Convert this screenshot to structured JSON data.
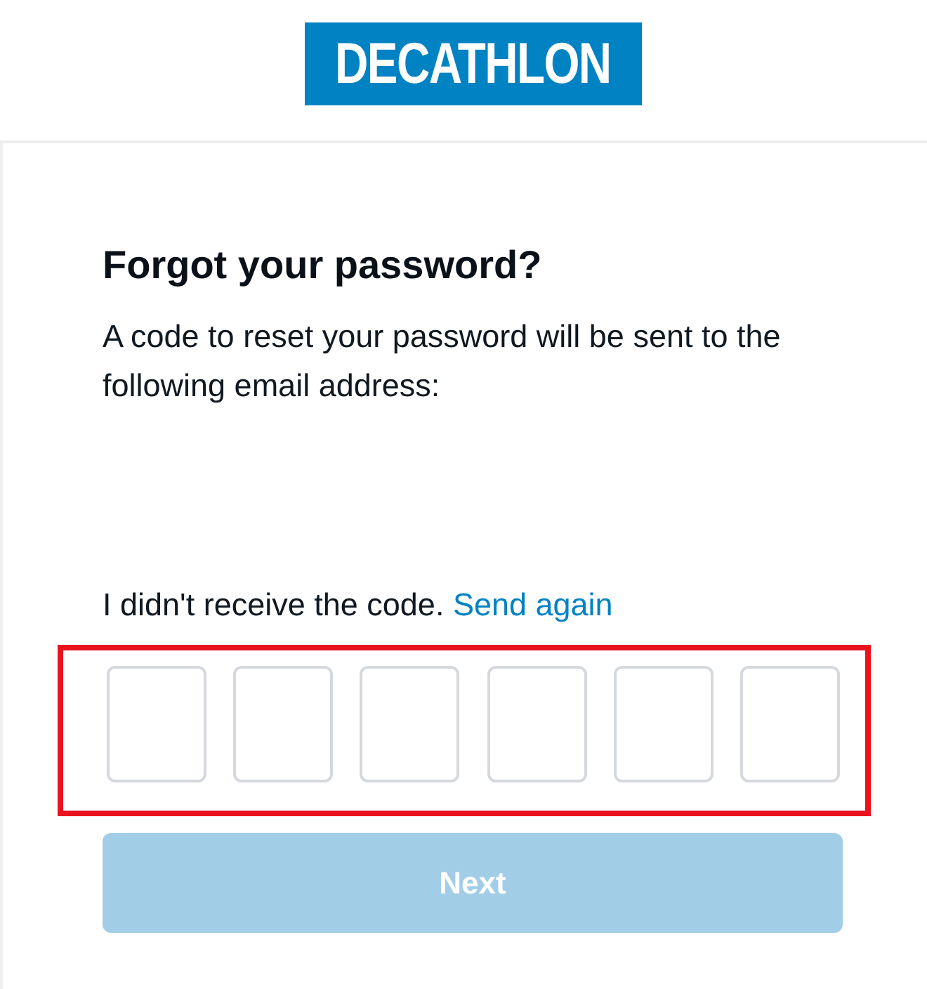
{
  "header": {
    "logo": "DECATHLON"
  },
  "form": {
    "title": "Forgot your password?",
    "description": "A code to reset your password will be sent to the following email address:",
    "resend": {
      "text": "I didn't receive the code.",
      "link": "Send again"
    },
    "code_entry": {
      "highlighted": true,
      "fields": [
        {
          "focused": false
        },
        {
          "focused": false
        },
        {
          "focused": false
        },
        {
          "focused": false
        },
        {
          "focused": false
        },
        {
          "focused": false
        }
      ]
    },
    "next_button": {
      "label": "Next",
      "disabled": true
    }
  }
}
